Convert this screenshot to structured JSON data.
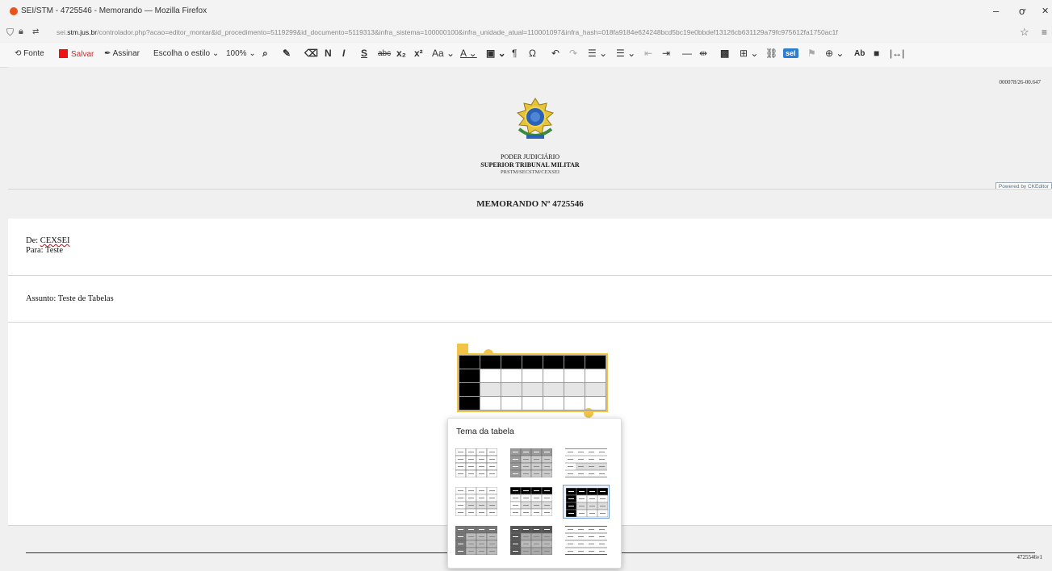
{
  "window": {
    "title": "SEI/STM - 4725546 - Memorando — Mozilla Firefox",
    "controls": {
      "minimize": "–",
      "maximize": "ơ",
      "close": "✕"
    }
  },
  "urlbar": {
    "host_pre": "sei.",
    "host": "stm.jus.br",
    "path": "/controlador.php?acao=editor_montar&id_procedimento=5119299&id_documento=5119313&infra_sistema=100000100&infra_unidade_atual=110001097&infra_hash=018fa9184e624248bcd5bc19e0bbdef13126cb631129a79fc975612fa1750ac1f",
    "star": "☆",
    "menu": "≡"
  },
  "toolbar": {
    "fonte": "Fonte",
    "salvar": "Salvar",
    "assinar": "Assinar",
    "estilo": "Escolha o estilo",
    "zoom": "100%",
    "sel": "sel"
  },
  "doc": {
    "number": "000078/26-00.647",
    "org": [
      "PODER JUDICIÁRIO",
      "SUPERIOR TRIBUNAL MILITAR",
      "PRSTM/SECSTM/CEXSEI"
    ],
    "powered": "Powered by CKEditor",
    "memo_title": "MEMORANDO Nº 4725546",
    "de_label": "De:",
    "de_value": "CEXSEI",
    "para": "Para: Teste",
    "assunto": "Assunto: Teste de Tabelas",
    "footer_num": "4725546v1"
  },
  "popup": {
    "title": "Tema da tabela",
    "themes": [
      "theme-1",
      "theme-2",
      "theme-3",
      "theme-4",
      "theme-5",
      "theme-6",
      "theme-7",
      "theme-8",
      "theme-9"
    ],
    "selected_index": 5
  }
}
